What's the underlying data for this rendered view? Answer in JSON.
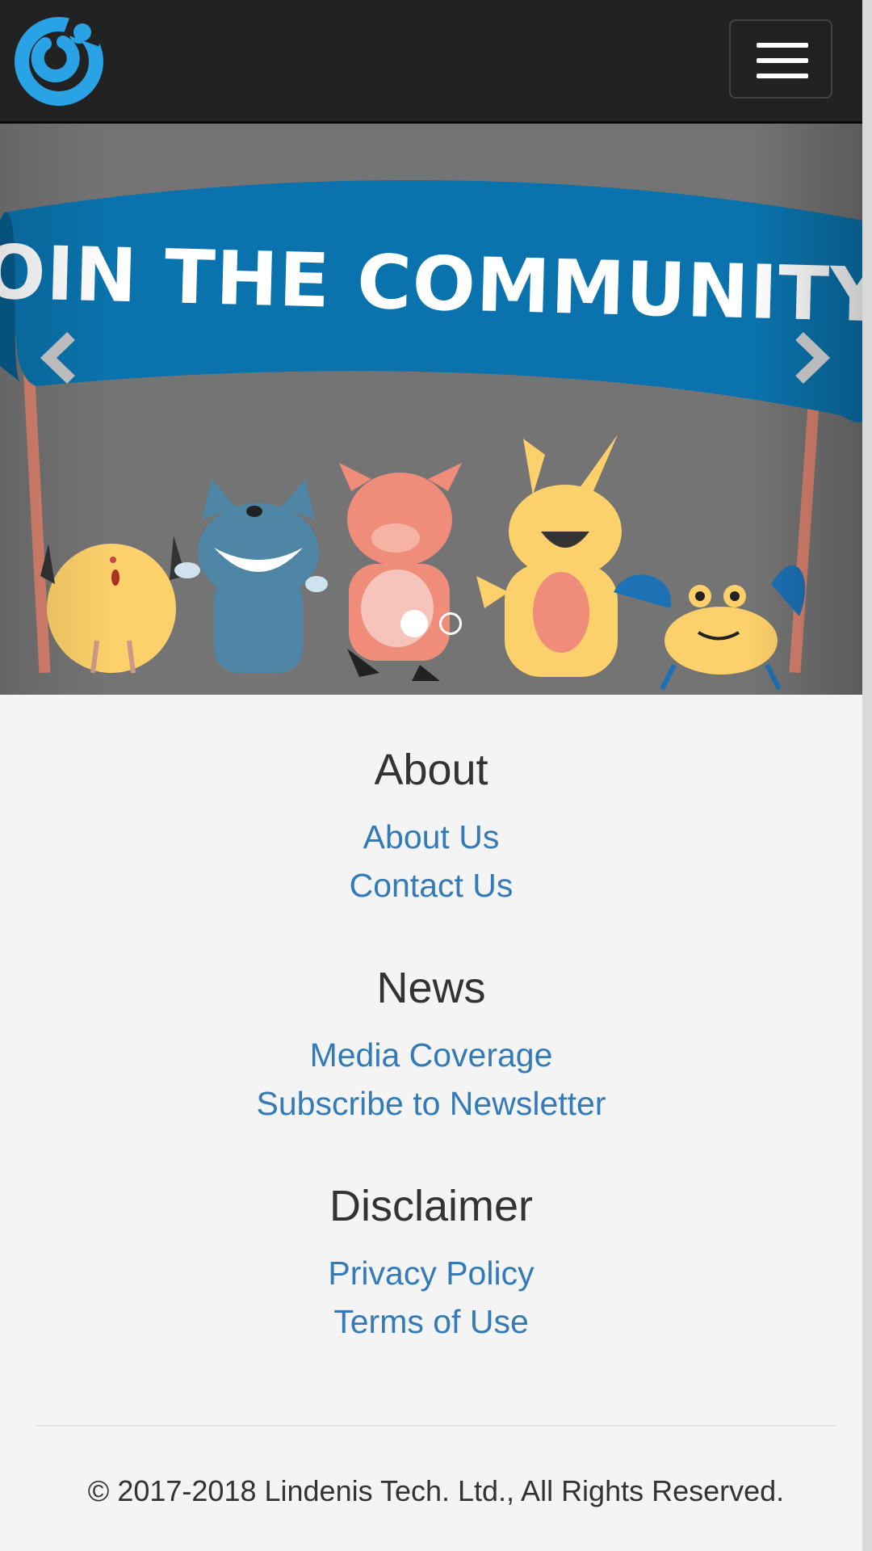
{
  "navbar": {
    "logo_icon": "circle-logo-icon",
    "menu_icon": "hamburger-menu-icon",
    "colors": {
      "background": "#222222",
      "logo": "#29a3e6"
    }
  },
  "carousel": {
    "banner_text": "JOIN THE COMMUNITY!",
    "slides_count": 2,
    "active_slide": 1,
    "prev_icon": "chevron-left-icon",
    "next_icon": "chevron-right-icon",
    "colors": {
      "banner": "#0a73ad",
      "background": "#747474"
    }
  },
  "footer": {
    "sections": [
      {
        "title": "About",
        "links": [
          "About Us",
          "Contact Us"
        ]
      },
      {
        "title": "News",
        "links": [
          "Media Coverage",
          "Subscribe to Newsletter"
        ]
      },
      {
        "title": "Disclaimer",
        "links": [
          "Privacy Policy",
          "Terms of Use"
        ]
      }
    ],
    "copyright": "© 2017-2018 Lindenis Tech. Ltd., All Rights Reserved.",
    "colors": {
      "link": "#337ab7",
      "heading": "#333333"
    }
  }
}
